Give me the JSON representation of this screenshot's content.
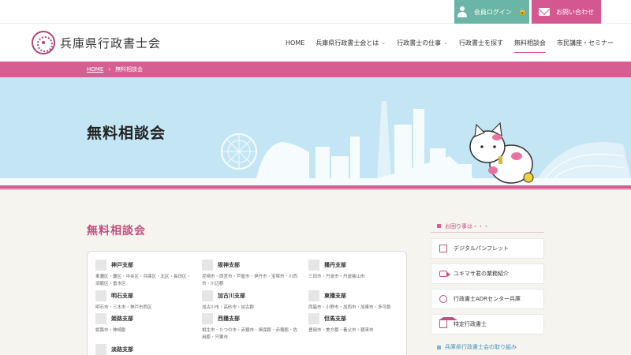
{
  "utility": {
    "login_label": "会員ログイン",
    "lock_glyph": "🔒",
    "contact_label": "お問い合わせ"
  },
  "header": {
    "logo_text": "兵庫県行政書士会"
  },
  "nav": {
    "items": [
      {
        "label": "HOME",
        "has_dropdown": false,
        "active": false
      },
      {
        "label": "兵庫県行政書士会とは",
        "has_dropdown": true,
        "active": false
      },
      {
        "label": "行政書士の仕事",
        "has_dropdown": true,
        "active": false
      },
      {
        "label": "行政書士を探す",
        "has_dropdown": false,
        "active": false
      },
      {
        "label": "無料相談会",
        "has_dropdown": false,
        "active": true
      },
      {
        "label": "市民講座・セミナー",
        "has_dropdown": false,
        "active": false
      }
    ],
    "chevron": "⌄"
  },
  "breadcrumb": {
    "home": "HOME",
    "separator": "›",
    "current": "無料相談会"
  },
  "hero": {
    "title": "無料相談会"
  },
  "main": {
    "title": "無料相談会",
    "branches": [
      {
        "name": "神戸支部",
        "areas": "東灘区・灘区・中央区・兵庫区・北区・長田区・須磨区・垂水区"
      },
      {
        "name": "阪神支部",
        "areas": "尼崎市・西宮市・芦屋市・伊丹市・宝塚市・川西市・川辺郡"
      },
      {
        "name": "播丹支部",
        "areas": "三田市・丹波市・丹波篠山市"
      },
      {
        "name": "明石支部",
        "areas": "明石市・三木市・神戸市西区"
      },
      {
        "name": "加古川支部",
        "areas": "加古川市・高砂市・加古郡"
      },
      {
        "name": "東播支部",
        "areas": "西脇市・小野市・加西市・加東市・多可郡"
      },
      {
        "name": "姫路支部",
        "areas": "姫路市・神崎郡"
      },
      {
        "name": "西播支部",
        "areas": "相生市・たつの市・赤穂市・揖保郡・赤穂郡・佐用郡・宍粟市"
      },
      {
        "name": "但馬支部",
        "areas": "豊岡市・美方郡・養父市・朝来市"
      },
      {
        "name": "淡路支部",
        "areas": ""
      }
    ]
  },
  "sidebar": {
    "heading": "お困り事は・・・",
    "items": [
      {
        "label": "デジタルパンフレット",
        "icon": "book-icon"
      },
      {
        "label": "ユキマサ君の業務紹介",
        "icon": "video-icon"
      },
      {
        "label": "行政書士ADRセンター兵庫",
        "icon": "chat-icon"
      },
      {
        "label": "特定行政書士",
        "icon": "building-icon"
      }
    ],
    "heading2": "兵庫県行政書士会の取り組み"
  },
  "colors": {
    "pink": "#d55f91",
    "teal": "#6ab5a6",
    "sky": "#c4e6f4",
    "cream": "#f5f4ef"
  }
}
